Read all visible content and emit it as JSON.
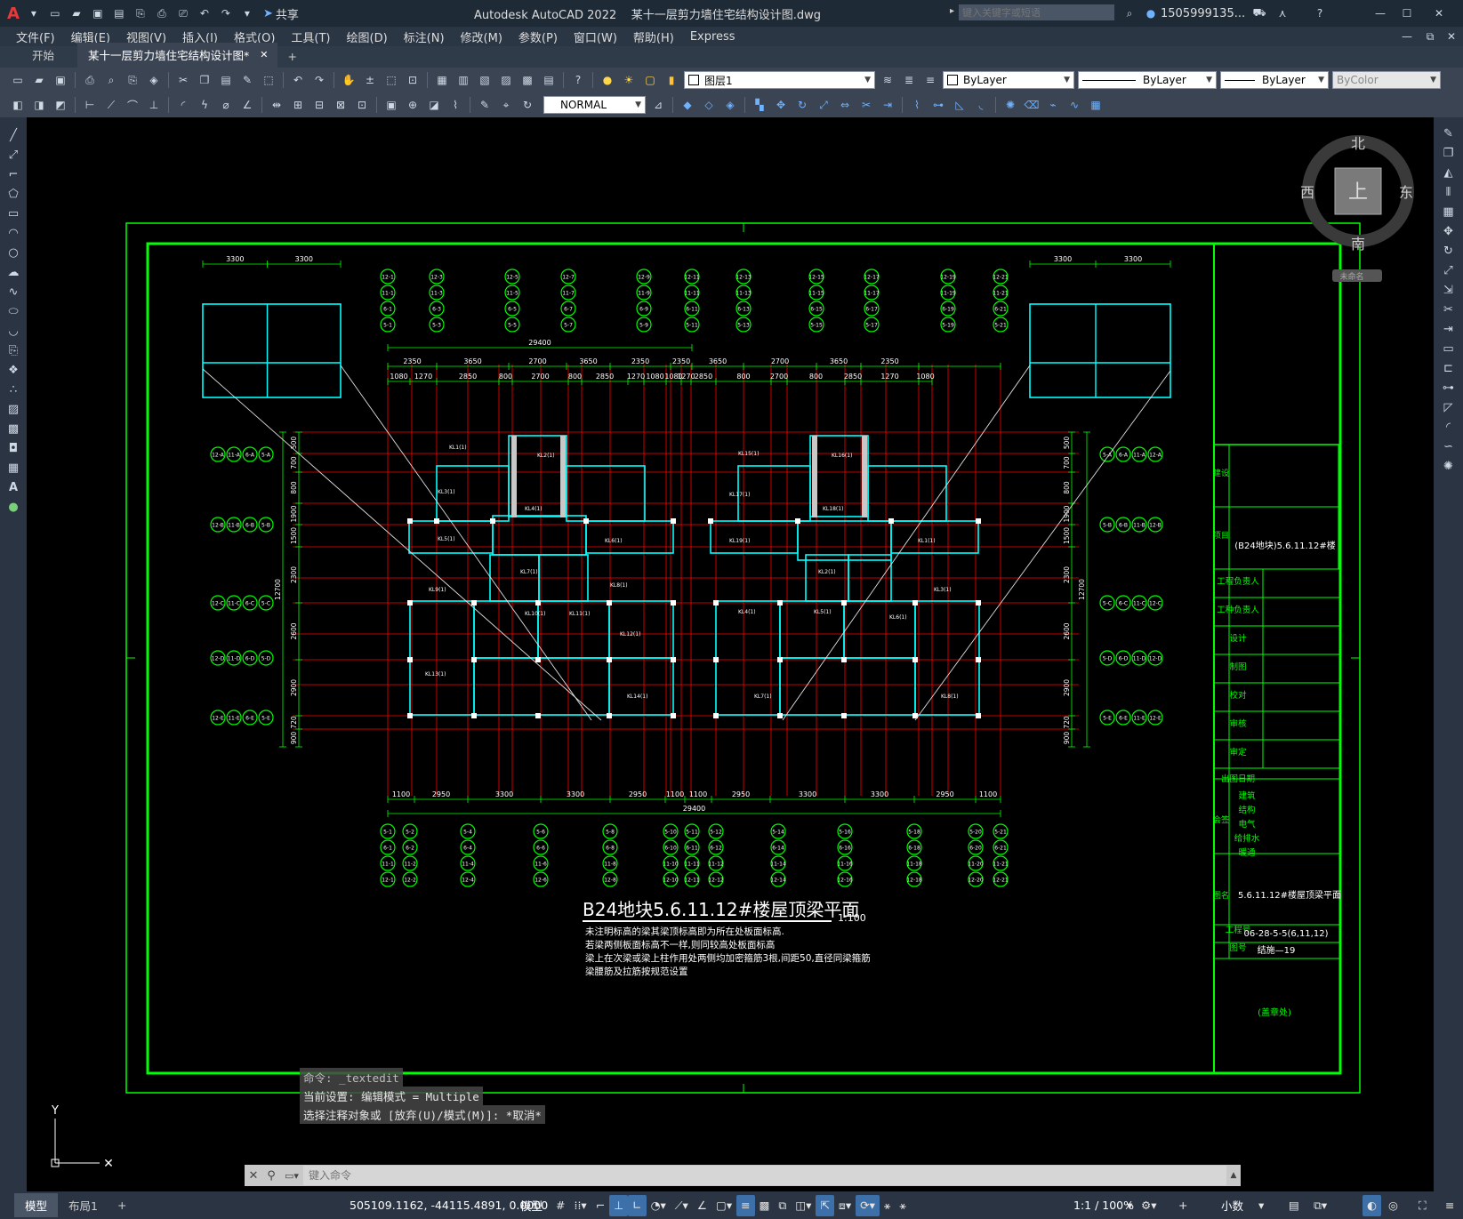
{
  "app": {
    "title": "Autodesk AutoCAD 2022    某十一层剪力墙住宅结构设计图.dwg",
    "share_label": "共享",
    "search_placeholder": "键入关键字或短语",
    "user": "1505999135...",
    "logo": "A"
  },
  "menu": [
    "文件(F)",
    "编辑(E)",
    "视图(V)",
    "插入(I)",
    "格式(O)",
    "工具(T)",
    "绘图(D)",
    "标注(N)",
    "修改(M)",
    "参数(P)",
    "窗口(W)",
    "帮助(H)",
    "Express"
  ],
  "tabs": [
    {
      "label": "开始",
      "active": false
    },
    {
      "label": "某十一层剪力墙住宅结构设计图*",
      "active": true
    }
  ],
  "toolbar": {
    "layer_value": "图层1",
    "color_value": "ByLayer",
    "linetype_value": "ByLayer",
    "lineweight_value": "ByLayer",
    "plotstyle_value": "ByColor",
    "dimstyle_value": "NORMAL"
  },
  "viewcube": {
    "north": "北",
    "south": "南",
    "east": "东",
    "west": "西",
    "face": "上",
    "wcs": "未命名"
  },
  "ucs": {
    "y": "Y"
  },
  "drawing": {
    "title": "B24地块5.6.11.12#楼屋顶梁平面",
    "scale": "1:100",
    "notes": [
      "未注明标高的梁其梁顶标高即为所在处板面标高.",
      "若梁两侧板面标高不一样,则同较高处板面标高",
      "梁上在次梁或梁上柱作用处两侧均加密箍筋3根,间距50,直径同梁箍筋",
      "梁腰筋及拉筋按规范设置"
    ],
    "total_dim": "29400",
    "top_dims_1": [
      "2350",
      "3650",
      "2700",
      "3650",
      "2350",
      "2350",
      "3650",
      "2700",
      "3650",
      "2350"
    ],
    "top_dims_2": [
      "1080",
      "1270",
      "2850",
      "800",
      "2700",
      "800",
      "2850",
      "1270",
      "1080",
      "1080",
      "1270",
      "2850",
      "800",
      "2700",
      "800",
      "2850",
      "1270",
      "1080"
    ],
    "bottom_dims": [
      "1100",
      "2950",
      "3300",
      "3300",
      "2950",
      "1100",
      "1100",
      "2950",
      "3300",
      "3300",
      "2950",
      "1100"
    ],
    "left_dims": [
      "500",
      "700",
      "800",
      "1900",
      "1500",
      "2300",
      "2600",
      "2900",
      "720",
      "900"
    ],
    "side_total": "12700",
    "inset_dims": [
      "3300",
      "3300"
    ],
    "axis_top": [
      [
        "12-1",
        "11-1",
        "6-1",
        "5-1"
      ],
      [
        "12-3",
        "11-3",
        "6-3",
        "5-3"
      ],
      [
        "12-5",
        "11-5",
        "6-5",
        "5-5"
      ],
      [
        "12-7",
        "11-7",
        "6-7",
        "5-7"
      ],
      [
        "12-9",
        "11-9",
        "6-9",
        "5-9"
      ],
      [
        "12-11",
        "11-11",
        "6-11",
        "5-11"
      ],
      [
        "12-13",
        "11-13",
        "6-13",
        "5-13"
      ],
      [
        "12-15",
        "11-15",
        "6-15",
        "5-15"
      ],
      [
        "12-17",
        "11-17",
        "6-17",
        "5-17"
      ],
      [
        "12-19",
        "11-19",
        "6-19",
        "5-19"
      ],
      [
        "12-21",
        "11-21",
        "6-21",
        "5-21"
      ]
    ],
    "axis_bottom": [
      [
        "5-1",
        "6-1",
        "11-1",
        "12-1"
      ],
      [
        "5-2",
        "6-2",
        "11-2",
        "12-2"
      ],
      [
        "5-4",
        "6-4",
        "11-4",
        "12-4"
      ],
      [
        "5-6",
        "6-6",
        "11-6",
        "12-6"
      ],
      [
        "5-8",
        "6-8",
        "11-8",
        "12-8"
      ],
      [
        "5-10",
        "6-10",
        "11-10",
        "12-10"
      ],
      [
        "5-11",
        "6-11",
        "11-11",
        "12-11"
      ],
      [
        "5-12",
        "6-12",
        "11-12",
        "12-12"
      ],
      [
        "5-14",
        "6-14",
        "11-14",
        "12-14"
      ],
      [
        "5-16",
        "6-16",
        "11-16",
        "12-16"
      ],
      [
        "5-18",
        "6-18",
        "11-18",
        "12-18"
      ],
      [
        "5-20",
        "6-20",
        "11-20",
        "12-20"
      ],
      [
        "5-21",
        "6-21",
        "11-21",
        "12-21"
      ]
    ],
    "axis_left": [
      [
        "12-A",
        "11-A",
        "6-A",
        "5-A"
      ],
      [
        "12-B",
        "11-B",
        "6-B",
        "5-B"
      ],
      [
        "12-C",
        "11-C",
        "6-C",
        "5-C"
      ],
      [
        "12-D",
        "11-D",
        "6-D",
        "5-D"
      ],
      [
        "12-E",
        "11-E",
        "6-E",
        "5-E"
      ]
    ],
    "axis_right": [
      [
        "5-A",
        "6-A",
        "11-A",
        "12-A"
      ],
      [
        "5-B",
        "6-B",
        "11-B",
        "12-B"
      ],
      [
        "5-C",
        "6-C",
        "11-C",
        "12-C"
      ],
      [
        "5-D",
        "6-D",
        "11-D",
        "12-D"
      ],
      [
        "5-E",
        "6-E",
        "11-E",
        "12-E"
      ]
    ],
    "beam_labels": [
      "KL1(1)",
      "KL2(1)",
      "KL3(1)",
      "KL4(1)",
      "KL5(1)",
      "KL6(1)",
      "KL7(1)",
      "KL8(1)",
      "KL9(1)",
      "KL10(1)",
      "KL11(1)",
      "KL12(1)",
      "KL13(1)",
      "KL14(1)",
      "KL15(1)",
      "KL16(1)",
      "KL17(1)",
      "KL18(1)",
      "KL19(1)"
    ]
  },
  "titleblock": {
    "rows": [
      "建设单位",
      "项目",
      "工程负责人",
      "工种负责人",
      "设计",
      "制图",
      "校对",
      "审核",
      "审定",
      "出图日期",
      "会签栏",
      "图名",
      "工程号",
      "图号"
    ],
    "project": "(B24地块)5.6.11.12#楼",
    "signoff": [
      "建筑",
      "结构",
      "电气",
      "给排水",
      "暖通"
    ],
    "drawing_name": "5.6.11.12#楼屋顶梁平面",
    "project_no": "06-28-5-5(6,11,12)",
    "drawing_no": "结施—19",
    "stamp": "(盖章处)"
  },
  "command": {
    "history": [
      "命令: _textedit",
      "当前设置: 编辑模式 = Multiple",
      "选择注释对象或 [放弃(U)/模式(M)]: *取消*"
    ],
    "placeholder": "键入命令"
  },
  "layout_tabs": [
    "模型",
    "布局1"
  ],
  "status": {
    "coords": "505109.1162, -44115.4891, 0.0000",
    "mode": "模型",
    "scale": "1:1 / 100%",
    "units": "小数"
  },
  "colors": {
    "frame": "#00ff00",
    "beam": "#00ffff",
    "axis": "#ff0000",
    "text": "#ffffff",
    "accent": "#3d6fa8"
  }
}
